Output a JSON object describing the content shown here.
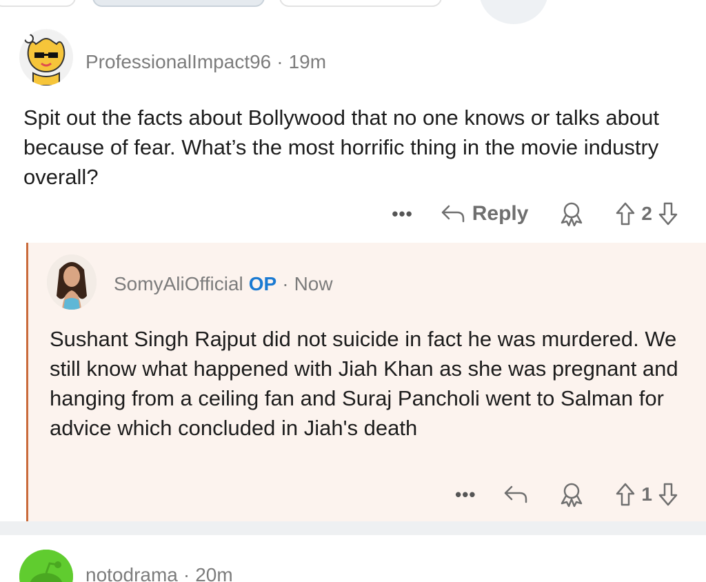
{
  "comments": [
    {
      "username": "ProfessionalImpact96",
      "separator": "·",
      "time": "19m",
      "body": "Spit out the facts about Bollywood that no one knows or talks about because of fear. What’s the most horrific thing in the movie industry overall?",
      "actions": {
        "more": "•••",
        "reply_label": "Reply",
        "votes": "2"
      }
    },
    {
      "username": "SomyAliOfficial",
      "op_badge": "OP",
      "separator": "·",
      "time": "Now",
      "body": "Sushant Singh Rajput did not suicide in fact he was murdered. We still know what happened with Jiah Khan as she was pregnant and hanging from a ceiling fan and Suraj Pancholi went to Salman for advice which concluded in Jiah's death",
      "actions": {
        "more": "•••",
        "votes": "1"
      }
    },
    {
      "username": "notodrama",
      "separator": "·",
      "time": "20m"
    }
  ],
  "colors": {
    "accent_op": "#1a7ad2",
    "thread_line": "#c96a3a",
    "reply_bg": "#fcf3ee"
  }
}
